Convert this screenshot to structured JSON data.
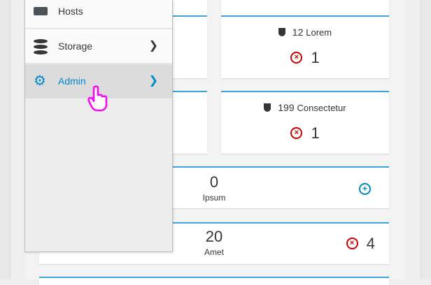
{
  "menu": {
    "items": [
      {
        "label": "Hosts",
        "icon": "server-icon",
        "has_submenu": false
      },
      {
        "label": "Storage",
        "icon": "database-icon",
        "has_submenu": true
      },
      {
        "label": "Admin",
        "icon": "gear-icon",
        "has_submenu": true,
        "active": true
      }
    ]
  },
  "cards": {
    "card1": {
      "count": "12",
      "label": "Lorem",
      "status_count": "1"
    },
    "card2": {
      "count": "199",
      "label": "Consectetur",
      "status_count": "1"
    },
    "card3": {
      "value": "0",
      "label": "Ipsum"
    },
    "card4": {
      "value": "20",
      "label": "Amet",
      "status_count": "4"
    }
  },
  "colors": {
    "accent": "#39a5dc",
    "link": "#0088ce",
    "error": "#cc0000",
    "cursor": "#ff00ff"
  }
}
